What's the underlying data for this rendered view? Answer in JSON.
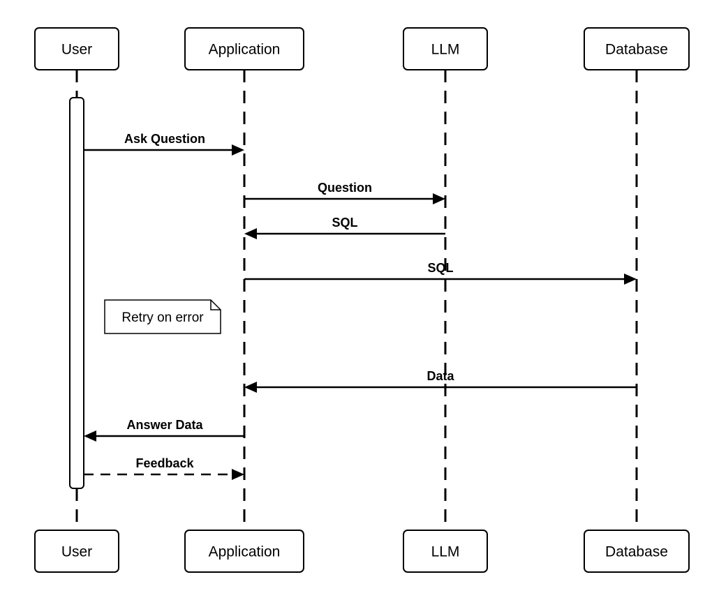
{
  "actors": {
    "user": "User",
    "application": "Application",
    "llm": "LLM",
    "database": "Database"
  },
  "messages": {
    "m1": "Ask Question",
    "m2": "Question",
    "m3": "SQL",
    "m4": "SQL",
    "m5": "Data",
    "m6": "Answer Data",
    "m7": "Feedback"
  },
  "note": "Retry on error"
}
